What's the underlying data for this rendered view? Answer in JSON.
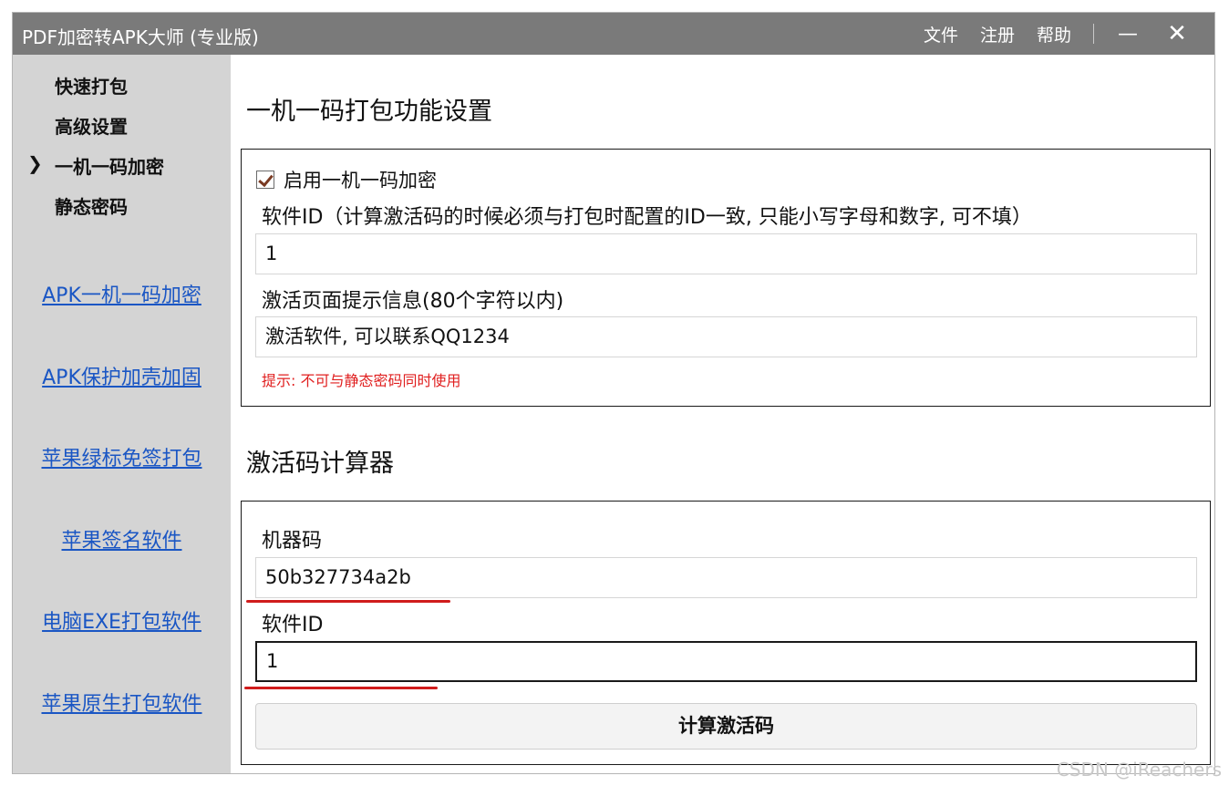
{
  "window": {
    "title": "PDF加密转APK大师 (专业版)",
    "menu": [
      "文件",
      "注册",
      "帮助"
    ],
    "minimize_glyph": "—",
    "close_glyph": "✕"
  },
  "sidebar": {
    "nav": [
      {
        "label": "快速打包",
        "active": false
      },
      {
        "label": "高级设置",
        "active": false
      },
      {
        "label": "一机一码加密",
        "active": true
      },
      {
        "label": "静态密码",
        "active": false
      }
    ],
    "active_marker": "❯",
    "links": [
      "APK一机一码加密",
      "APK保护加壳加固",
      "苹果绿标免签打包",
      "苹果签名软件",
      "电脑EXE打包软件",
      "苹果原生打包软件"
    ]
  },
  "settings": {
    "title": "一机一码打包功能设置",
    "enable_checkbox": {
      "label": "启用一机一码加密",
      "checked": true
    },
    "software_id_label": "软件ID（计算激活码的时候必须与打包时配置的ID一致, 只能小写字母和数字, 可不填）",
    "software_id_value": "1",
    "activation_tip_label": "激活页面提示信息(80个字符以内)",
    "activation_tip_value": "激活软件, 可以联系QQ1234",
    "hint": "提示: 不可与静态密码同时使用"
  },
  "calculator": {
    "title": "激活码计算器",
    "machine_code_label": "机器码",
    "machine_code_value": "50b327734a2b",
    "software_id_label": "软件ID",
    "software_id_value": "1",
    "button_label": "计算激活码"
  },
  "watermark": "CSDN @iReachers",
  "colors": {
    "titlebar": "#7a7a7a",
    "sidebar": "#d4d4d4",
    "link": "#1a56c4",
    "hint": "#e01f1f",
    "annotation_underline": "#d01c1c"
  }
}
